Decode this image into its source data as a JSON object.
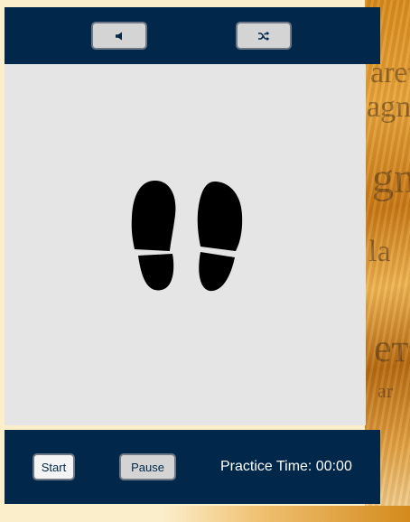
{
  "controls": {
    "sound_icon": "speaker-icon",
    "shuffle_icon": "shuffle-icon"
  },
  "stage": {
    "image_icon": "footprints-icon"
  },
  "footer": {
    "start_label": "Start",
    "pause_label": "Pause",
    "timer_text": "Practice Time: 00:00"
  },
  "colors": {
    "panel": "#01284a",
    "stage": "#e5e5e5",
    "button": "#d4d4d4",
    "page_background": "#fbeecb"
  }
}
